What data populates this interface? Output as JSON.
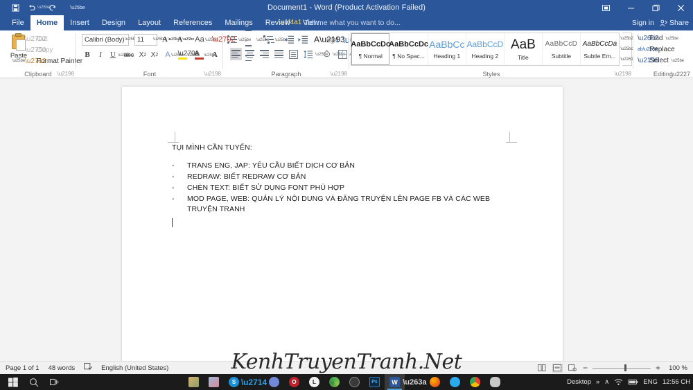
{
  "titlebar": {
    "document_title": "Document1 - Word (Product Activation Failed)",
    "quick_access": [
      {
        "name": "save",
        "glyph": "save-icon"
      },
      {
        "name": "undo",
        "glyph": "undo-icon"
      },
      {
        "name": "redo",
        "glyph": "redo-icon"
      },
      {
        "name": "customize",
        "glyph": "customize-qat-icon"
      }
    ],
    "window_controls": [
      {
        "name": "ribbon-display-options",
        "glyph": "⬚"
      },
      {
        "name": "minimize",
        "glyph": "–"
      },
      {
        "name": "restore",
        "glyph": "❐"
      },
      {
        "name": "close",
        "glyph": "✕"
      }
    ]
  },
  "tabs": [
    {
      "label": "File",
      "active": false
    },
    {
      "label": "Home",
      "active": true
    },
    {
      "label": "Insert",
      "active": false
    },
    {
      "label": "Design",
      "active": false
    },
    {
      "label": "Layout",
      "active": false
    },
    {
      "label": "References",
      "active": false
    },
    {
      "label": "Mailings",
      "active": false
    },
    {
      "label": "Review",
      "active": false
    },
    {
      "label": "View",
      "active": false
    }
  ],
  "tell_me": "Tell me what you want to do...",
  "account": {
    "sign_in": "Sign in",
    "share": "Share"
  },
  "ribbon": {
    "clipboard": {
      "group_label": "Clipboard",
      "paste_label": "Paste",
      "items": [
        {
          "label": "Cut",
          "icon": "scissors-icon"
        },
        {
          "label": "Copy",
          "icon": "copy-icon"
        },
        {
          "label": "Format Painter",
          "icon": "format-painter-icon"
        }
      ]
    },
    "font": {
      "group_label": "Font",
      "font_name": "Calibri (Body)",
      "font_size": "11",
      "buttons": [
        "grow-font-icon",
        "shrink-font-icon",
        "change-case-icon",
        "clear-formatting-icon",
        "text-effects-icon",
        "character-border-icon",
        "bold-icon",
        "italic-icon",
        "underline-icon",
        "strikethrough-icon",
        "subscript-icon",
        "superscript-icon",
        "text-highlight-icon",
        "font-color-icon",
        "character-shading-icon",
        "phonetic-guide-icon"
      ]
    },
    "paragraph": {
      "group_label": "Paragraph",
      "buttons": [
        "bullets-icon",
        "numbering-icon",
        "multilevel-list-icon",
        "decrease-indent-icon",
        "increase-indent-icon",
        "sort-icon",
        "show-formatting-marks-icon",
        "align-left-icon",
        "center-icon",
        "align-right-icon",
        "justify-icon",
        "line-spacing-icon",
        "shading-icon",
        "borders-icon"
      ]
    },
    "styles": {
      "group_label": "Styles",
      "gallery": [
        {
          "preview": "AaBbCcDc",
          "name": "¶ Normal",
          "selected": true,
          "color": "#1c1c1c",
          "weight": "bold",
          "size": 11,
          "style": "normal"
        },
        {
          "preview": "AaBbCcDc",
          "name": "¶ No Spac...",
          "selected": false,
          "color": "#1c1c1c",
          "weight": "bold",
          "size": 11,
          "style": "normal"
        },
        {
          "preview": "AaBbCc",
          "name": "Heading 1",
          "selected": false,
          "color": "#5b9bd5",
          "weight": "normal",
          "size": 14,
          "style": "normal"
        },
        {
          "preview": "AaBbCcD",
          "name": "Heading 2",
          "selected": false,
          "color": "#5b9bd5",
          "weight": "normal",
          "size": 12,
          "style": "normal"
        },
        {
          "preview": "AaB",
          "name": "Title",
          "selected": false,
          "color": "#1c1c1c",
          "weight": "normal",
          "size": 19,
          "style": "normal"
        },
        {
          "preview": "AaBbCcD",
          "name": "Subtitle",
          "selected": false,
          "color": "#666666",
          "weight": "normal",
          "size": 10,
          "style": "normal"
        },
        {
          "preview": "AaBbCcDa",
          "name": "Subtle Em...",
          "selected": false,
          "color": "#1c1c1c",
          "weight": "normal",
          "size": 10,
          "style": "italic"
        }
      ]
    },
    "editing": {
      "group_label": "Editing",
      "items": [
        {
          "label": "Find",
          "icon": "magnifier-icon",
          "caret": true
        },
        {
          "label": "Replace",
          "icon": "replace-icon",
          "caret": false
        },
        {
          "label": "Select",
          "icon": "select-icon",
          "caret": true
        }
      ]
    }
  },
  "document": {
    "heading": "TỤI MÌNH CẦN TUYỂN:",
    "list_marker": "-",
    "items": [
      "TRANS ENG, JAP: YÊU CẦU BIẾT DỊCH CƠ BẢN",
      "REDRAW: BIẾT REDRAW CƠ BẢN",
      "CHÈN TEXT: BIẾT SỬ DỤNG FONT PHÙ HỢP",
      "MOD PAGE, WEB: QUẢN LÝ NỘI DUNG VÀ ĐĂNG TRUYỆN LÊN PAGE FB VÀ CÁC WEB TRUYỆN TRANH"
    ]
  },
  "status_bar": {
    "page": "Page 1 of 1",
    "words": "48 words",
    "proofing_icon": "spelling-check-icon",
    "language": "English (United States)",
    "view_buttons": [
      {
        "name": "read-mode",
        "active": false
      },
      {
        "name": "print-layout",
        "active": true
      },
      {
        "name": "web-layout",
        "active": false
      }
    ],
    "zoom_out": "−",
    "zoom_in": "+",
    "zoom_level": "100 %"
  },
  "watermark": "KenhTruyenTranh.Net",
  "taskbar": {
    "start_icon": "windows-start-icon",
    "search_icon": "search-icon",
    "taskview_icon": "task-view-icon",
    "apps": [
      {
        "name": "photos-app",
        "label": "",
        "color": "#c8a060",
        "active": false
      },
      {
        "name": "gallery-app",
        "label": "",
        "color": "#8fa8c8",
        "active": false
      },
      {
        "name": "skype-app",
        "label": "S",
        "color": "#1a8fd4",
        "active": false
      },
      {
        "name": "tick-app",
        "label": "✔",
        "color": "#1b1b1b",
        "active": false
      },
      {
        "name": "discord-app",
        "label": "",
        "color": "#7289da",
        "active": false
      },
      {
        "name": "opera-app",
        "label": "O",
        "color": "#c0202c",
        "active": false
      },
      {
        "name": "line-app",
        "label": "L",
        "color": "#f0f0f0",
        "active": false
      },
      {
        "name": "chrome-canary-app",
        "label": "",
        "color": "#48a14d",
        "active": false
      },
      {
        "name": "steam-app",
        "label": "",
        "color": "#5a5a5a",
        "active": false
      },
      {
        "name": "photoshop-app",
        "label": "Ps",
        "color": "#1b3a5c",
        "active": false
      },
      {
        "name": "word-app",
        "label": "W",
        "color": "#2b579a",
        "active": true
      },
      {
        "name": "people-app",
        "label": "",
        "color": "#8a8a8a",
        "active": false
      },
      {
        "name": "firefox-app",
        "label": "",
        "color": "#e8721c",
        "active": false
      },
      {
        "name": "telegram-app",
        "label": "",
        "color": "#2aabee",
        "active": false
      },
      {
        "name": "chrome-app",
        "label": "",
        "color": "#e8a020",
        "active": false
      },
      {
        "name": "paint-app",
        "label": "",
        "color": "#b0b0b0",
        "active": false
      }
    ],
    "tray": {
      "desktop_label": "Desktop",
      "overflow": "»",
      "chevron": "∧",
      "network_icon": "wifi-icon",
      "battery_icon": "battery-icon",
      "language": "ENG",
      "time": "12:56 CH"
    }
  }
}
